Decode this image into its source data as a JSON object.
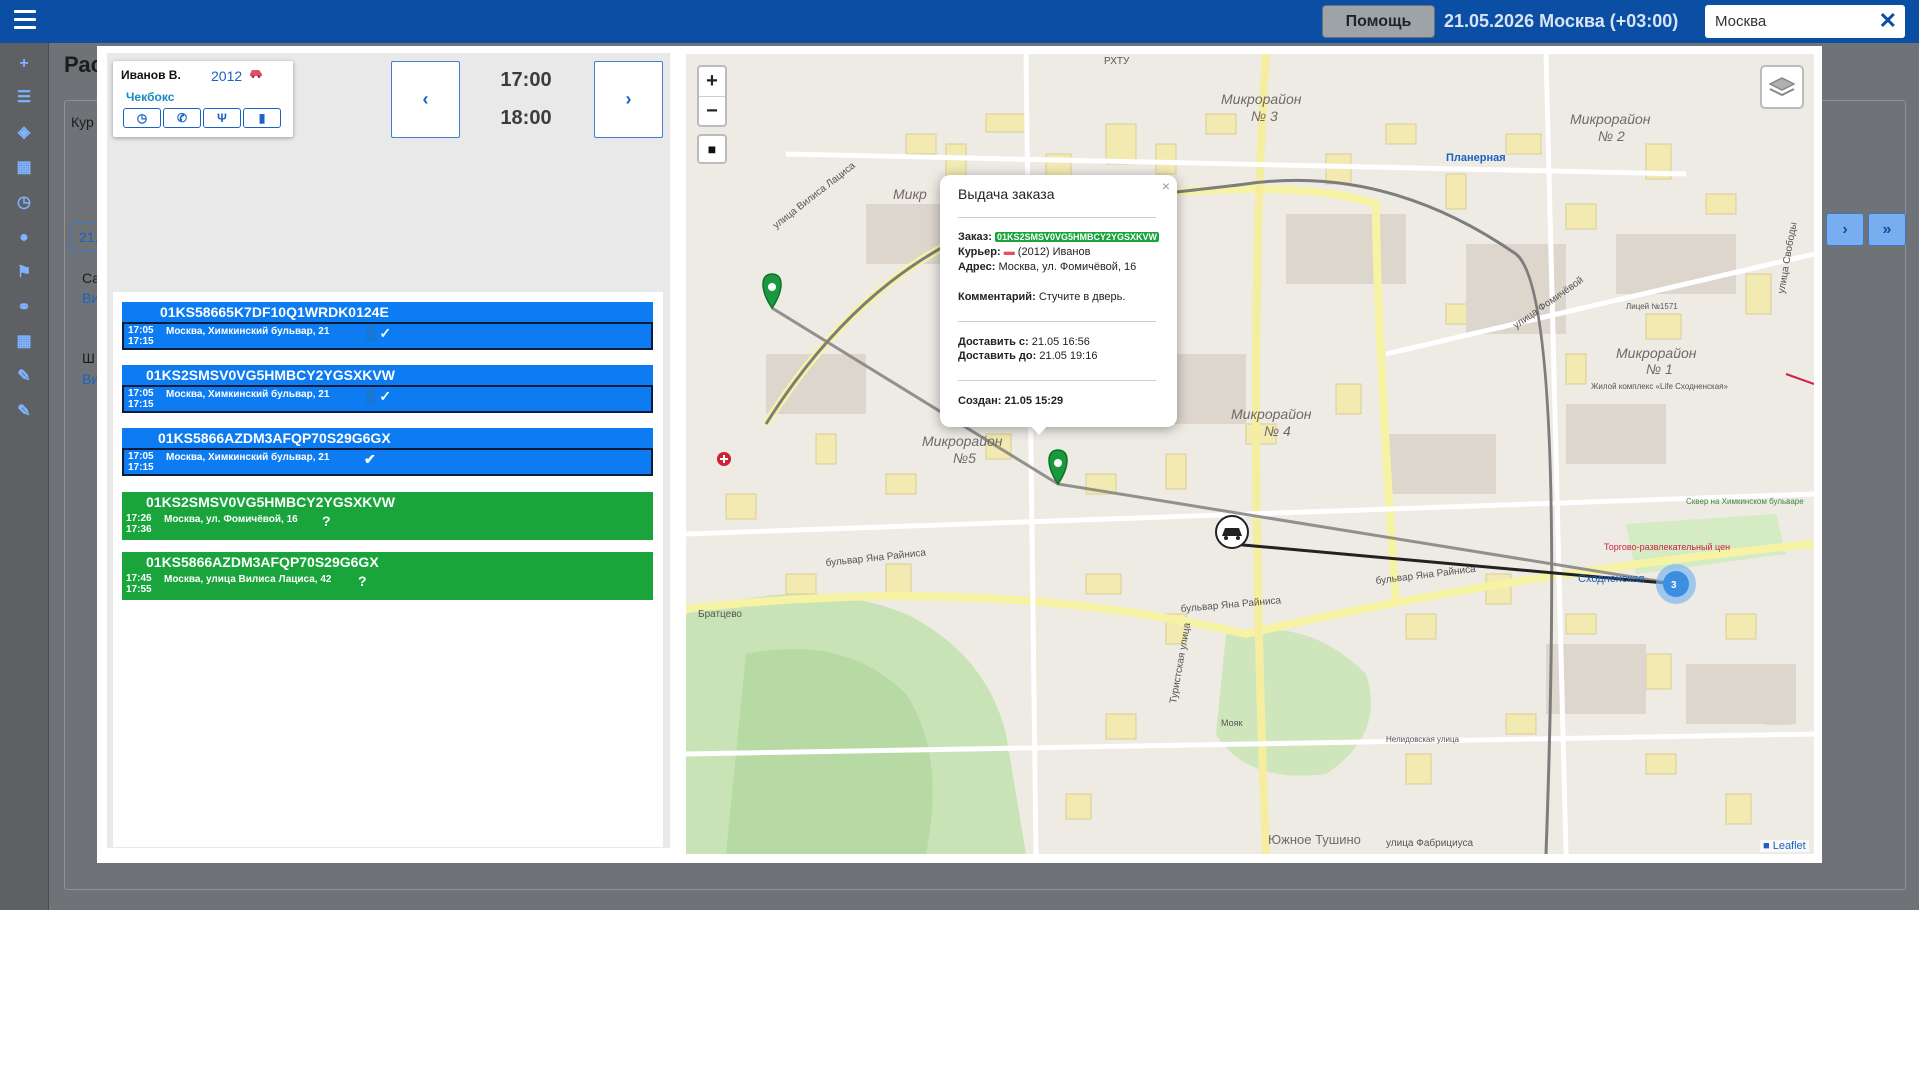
{
  "topbar": {
    "help_label": "Помощь",
    "date_city": "21.05.2026  Москва  (+03:00)",
    "city_value": "Москва",
    "clear_glyph": "✕"
  },
  "leftnav": {
    "items": [
      {
        "glyph": "+",
        "name": "add-icon"
      },
      {
        "glyph": "☰",
        "name": "list-icon"
      },
      {
        "glyph": "◈",
        "name": "layers-icon"
      },
      {
        "glyph": "▦",
        "name": "table-icon"
      },
      {
        "glyph": "◷",
        "name": "clock-icon"
      },
      {
        "glyph": "●",
        "name": "user-icon"
      },
      {
        "glyph": "⚑",
        "name": "flag-icon"
      },
      {
        "glyph": "⚭",
        "name": "group-icon"
      },
      {
        "glyph": "▦",
        "name": "grid-icon"
      },
      {
        "glyph": "✎",
        "name": "brush-icon"
      },
      {
        "glyph": "✎",
        "name": "brush-alt-icon"
      }
    ]
  },
  "background": {
    "title": "Рас",
    "label_kur": "Кур",
    "date_btn": "21.",
    "row1": "Са",
    "row1_link": "Ви",
    "row2": "Ш",
    "row2_link": "Ви",
    "next": "›",
    "last": "»"
  },
  "courier": {
    "name": "Иванов В.",
    "number": "2012",
    "car_icon_color": "#e0506a",
    "sub": "Чекбокс",
    "buttons": [
      {
        "name": "clock-icon",
        "glyph": "◷"
      },
      {
        "name": "phone-icon",
        "glyph": "✆"
      },
      {
        "name": "food-icon",
        "glyph": "Ψ"
      },
      {
        "name": "signal-icon",
        "glyph": "▮"
      }
    ]
  },
  "timeslot": {
    "prev": "‹",
    "next": "›",
    "from": "17:00",
    "to": "18:00"
  },
  "orders": [
    {
      "id": "01KS58665K7DF10Q1WRDK0124E",
      "color": "blue",
      "t1": "17:05",
      "t2": "17:15",
      "address": "Москва, Химкинский бульвар, 21",
      "icon": "user-check-icon",
      "glyph": "👤✓"
    },
    {
      "id": "01KS2SMSV0VG5HMBCY2YGSXKVW",
      "color": "blue",
      "t1": "17:05",
      "t2": "17:15",
      "address": "Москва, Химкинский бульвар, 21",
      "icon": "user-check-icon",
      "glyph": "👤✓"
    },
    {
      "id": "01KS5866AZDM3AFQP70S29G6GX",
      "color": "blue",
      "t1": "17:05",
      "t2": "17:15",
      "address": "Москва, Химкинский бульвар, 21",
      "icon": "check-circle-icon",
      "glyph": "✔"
    },
    {
      "id": "01KS2SMSV0VG5HMBCY2YGSXKVW",
      "color": "green",
      "t1": "17:26",
      "t2": "17:36",
      "address": "Москва, ул. Фомичёвой, 16",
      "icon": "question-icon",
      "glyph": "?"
    },
    {
      "id": "01KS5866AZDM3AFQP70S29G6GX",
      "color": "green",
      "t1": "17:45",
      "t2": "17:55",
      "address": "Москва, улица Вилиса Лациса, 42",
      "icon": "question-icon",
      "glyph": "?"
    }
  ],
  "map": {
    "zoom_in": "+",
    "zoom_out": "−",
    "stop": "■",
    "attribution": "Leaflet",
    "cluster_count": "3",
    "labels": [
      {
        "text": "Микрорайон",
        "cls": "district"
      },
      {
        "text": "№ 3",
        "cls": "district"
      },
      {
        "text": "Микрорайон",
        "cls": "district"
      },
      {
        "text": "№ 2",
        "cls": "district"
      },
      {
        "text": "Микрорайон",
        "cls": "district"
      },
      {
        "text": "№ 1",
        "cls": "district"
      },
      {
        "text": "Микрорайон",
        "cls": "district"
      },
      {
        "text": "№ 4",
        "cls": "district"
      },
      {
        "text": "Микрорайон",
        "cls": "district"
      },
      {
        "text": "№5",
        "cls": "district"
      },
      {
        "text": "Микр",
        "cls": "district"
      },
      {
        "text": "Планерная",
        "cls": "metro"
      },
      {
        "text": "бульвар Яна Райниса",
        "cls": "street"
      },
      {
        "text": "бульвар Яна Райниса",
        "cls": "street"
      },
      {
        "text": "бульвар Яна Райниса",
        "cls": "street"
      },
      {
        "text": "Братцево",
        "cls": "small"
      },
      {
        "text": "Южное Тушино",
        "cls": "district-sm"
      },
      {
        "text": "улица Фабрициуса",
        "cls": "small"
      },
      {
        "text": "Нелидовская улица",
        "cls": "small"
      },
      {
        "text": "Мояк",
        "cls": "small"
      },
      {
        "text": "Сходненская",
        "cls": "metro"
      },
      {
        "text": "Торгово-развлекательный цен",
        "cls": "poi"
      },
      {
        "text": "Лицей №1571",
        "cls": "small"
      },
      {
        "text": "Жилой комплекс «Life Сходненская»",
        "cls": "small"
      },
      {
        "text": "Сквер на Химкинском бульваре",
        "cls": "park"
      },
      {
        "text": "Туристская улица",
        "cls": "small"
      },
      {
        "text": "улица Фомичёвой",
        "cls": "small"
      },
      {
        "text": "улица Вилиса Лациса",
        "cls": "small"
      },
      {
        "text": "РХТУ",
        "cls": "small"
      },
      {
        "text": "улица Свободы",
        "cls": "small"
      }
    ]
  },
  "popup": {
    "title": "Выдача заказа",
    "close": "×",
    "order_label": "Заказ:",
    "order_id": "01KS2SMSV0VG5HMBCY2YGSXKVW",
    "courier_label": "Курьер:",
    "courier_value": "(2012) Иванов",
    "address_label": "Адрес:",
    "address_value": "Москва, ул. Фомичёвой, 16",
    "comment_label": "Комментарий:",
    "comment_value": "Стучите в дверь.",
    "deliver_from_label": "Доставить с:",
    "deliver_from_value": "21.05 16:56",
    "deliver_to_label": "Доставить до:",
    "deliver_to_value": "21.05 19:16",
    "created": "Создан: 21.05 15:29"
  },
  "colors": {
    "topbar": "#0b4fa5",
    "order_blue": "#0d7bf2",
    "order_green": "#19a43c",
    "marker_green": "#1a9a3c",
    "cluster": "#3c8ee0"
  }
}
